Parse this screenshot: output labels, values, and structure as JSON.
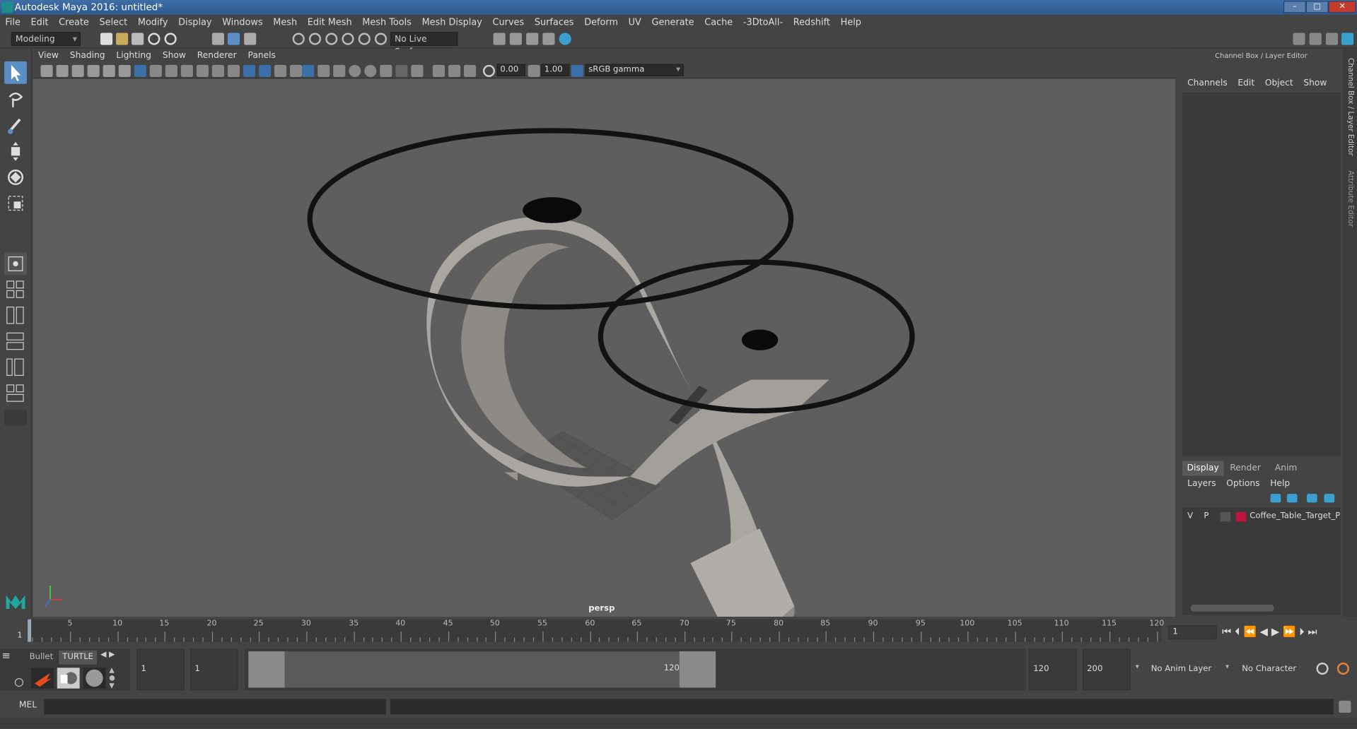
{
  "window": {
    "title": "Autodesk Maya 2016: untitled*",
    "controls": [
      "–",
      "□",
      "✕"
    ]
  },
  "menubar": [
    "File",
    "Edit",
    "Create",
    "Select",
    "Modify",
    "Display",
    "Windows",
    "Mesh",
    "Edit Mesh",
    "Mesh Tools",
    "Mesh Display",
    "Curves",
    "Surfaces",
    "Deform",
    "UV",
    "Generate",
    "Cache",
    "-3DtoAll-",
    "Redshift",
    "Help"
  ],
  "statusline": {
    "mode": "Modeling",
    "live_surface": "No Live Surface"
  },
  "viewport": {
    "menus": [
      "View",
      "Shading",
      "Lighting",
      "Show",
      "Renderer",
      "Panels"
    ],
    "exposure": "0.00",
    "gamma": "1.00",
    "color_space": "sRGB gamma",
    "camera_label": "persp"
  },
  "channel_box": {
    "header": "Channel Box / Layer Editor",
    "menus": [
      "Channels",
      "Edit",
      "Object",
      "Show"
    ]
  },
  "layer_editor": {
    "tabs": [
      "Display",
      "Render",
      "Anim"
    ],
    "menus": [
      "Layers",
      "Options",
      "Help"
    ],
    "layers": [
      {
        "v": "V",
        "p": "P",
        "color": "#c0143c",
        "name": "Coffee_Table_Target_Poin"
      }
    ]
  },
  "side_tabs": {
    "channel": "Channel Box / Layer Editor",
    "attribute": "Attribute Editor"
  },
  "timeline": {
    "current_frame": "1",
    "ticks": [
      "5",
      "10",
      "15",
      "20",
      "25",
      "30",
      "35",
      "40",
      "45",
      "50",
      "55",
      "60",
      "65",
      "70",
      "75",
      "80",
      "85",
      "90",
      "95",
      "100",
      "105",
      "110",
      "115",
      "120"
    ],
    "start_label": "1",
    "frame_field": "1"
  },
  "range": {
    "start": "1",
    "playback_start": "1",
    "slider_start": "1",
    "slider_end": "120",
    "playback_end": "120",
    "end": "200",
    "anim_layer": "No Anim Layer",
    "character_set": "No Character Set",
    "shelf_tabs": [
      "Bullet",
      "TURTLE"
    ]
  },
  "command": {
    "label": "MEL"
  }
}
